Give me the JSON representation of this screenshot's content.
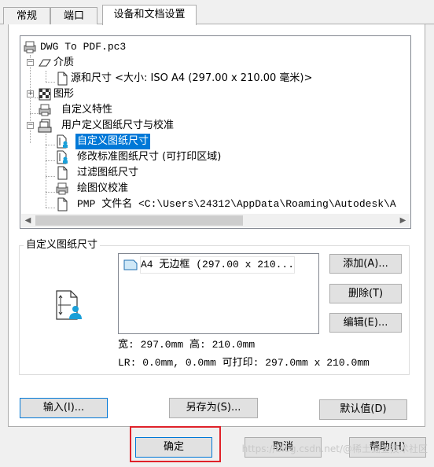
{
  "tabs": [
    {
      "label": "常规"
    },
    {
      "label": "端口"
    },
    {
      "label": "设备和文档设置"
    }
  ],
  "tree": {
    "root": "DWG To PDF.pc3",
    "media": "介质",
    "source_size": "源和尺寸 <大小: ISO A4 (297.00 x 210.00 毫米)>",
    "graphics": "图形",
    "custom_props": "自定义特性",
    "user_paper": "用户定义图纸尺寸与校准",
    "custom_paper": "自定义图纸尺寸",
    "modify_standard": "修改标准图纸尺寸 (可打印区域)",
    "filter_paper": "过滤图纸尺寸",
    "plotter_calib": "绘图仪校准",
    "pmp_file": "PMP 文件名 <C:\\Users\\24312\\AppData\\Roaming\\Autodesk\\A"
  },
  "group": {
    "title": "自定义图纸尺寸",
    "list_items": [
      "A4 无边框 (297.00 x 210..."
    ],
    "add_button": "添加(A)...",
    "delete_button": "删除(T)",
    "edit_button": "编辑(E)...",
    "size_info": "宽: 297.0mm 高: 210.0mm",
    "margin_info": "LR: 0.0mm, 0.0mm  可打印: 297.0mm x 210.0mm"
  },
  "bottom_buttons": {
    "import": "输入(I)...",
    "save_as": "另存为(S)...",
    "defaults": "默认值(D)"
  },
  "dialog_buttons": {
    "ok": "确定",
    "cancel": "取消",
    "help": "帮助(H)"
  },
  "watermark": "https://blog.csdn.net/@稀土掘金技术社区"
}
